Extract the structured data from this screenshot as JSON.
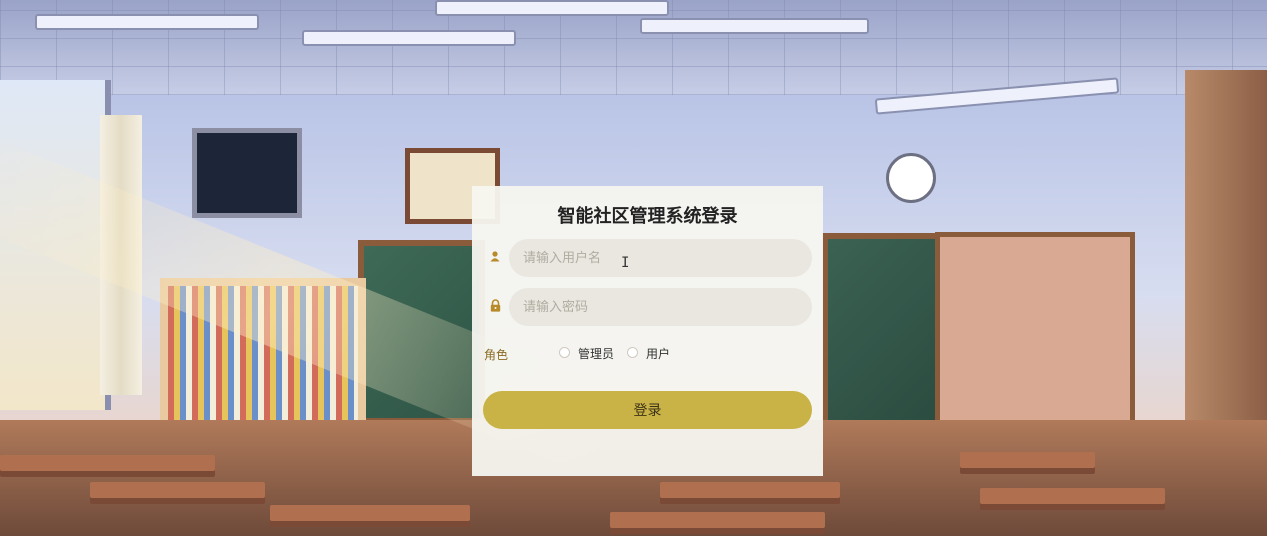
{
  "login": {
    "title": "智能社区管理系统登录",
    "username_placeholder": "请输入用户名",
    "username_value": "",
    "password_placeholder": "请输入密码",
    "password_value": "",
    "role_label": "角色",
    "roles": [
      "管理员",
      "用户"
    ],
    "selected_role": "",
    "submit_label": "登录"
  },
  "icons": {
    "username": "user-icon",
    "password": "lock-icon"
  },
  "colors": {
    "accent": "#c9b246",
    "icon": "#b88a2a",
    "card_background": "#f6f5f0",
    "input_background": "#e9e7df"
  }
}
